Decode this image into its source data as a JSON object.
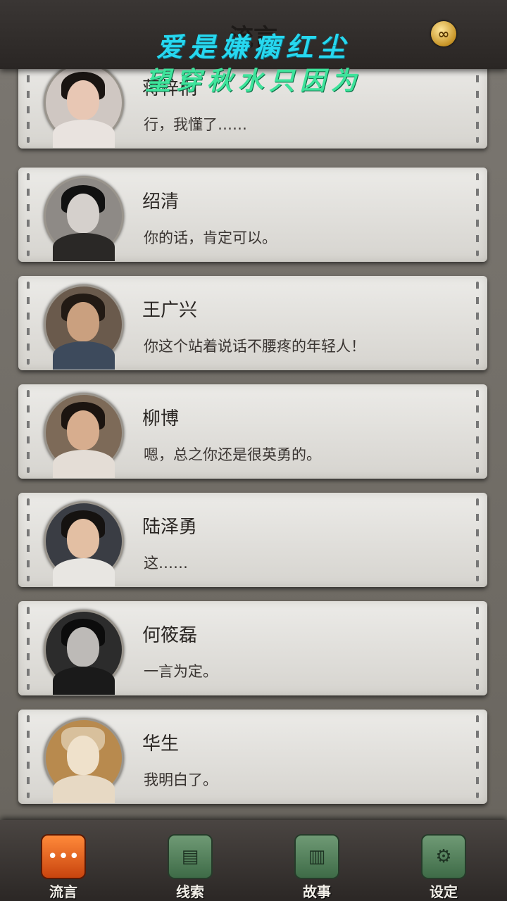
{
  "header": {
    "title": "流言",
    "overlay_line1": "爱是嫌瘸红尘",
    "overlay_line2": "望穿秋水只因为",
    "menu_icon": "infinity-coin-icon"
  },
  "messages": [
    {
      "name": "蒋梓桐",
      "text": "行，我懂了……",
      "avatar": "woman-avatar"
    },
    {
      "name": "绍清",
      "text": "你的话，肯定可以。",
      "avatar": "woman-avatar"
    },
    {
      "name": "王广兴",
      "text": "你这个站着说话不腰疼的年轻人！",
      "avatar": "man-glasses-avatar"
    },
    {
      "name": "柳博",
      "text": "嗯，总之你还是很英勇的。",
      "avatar": "man-avatar"
    },
    {
      "name": "陆泽勇",
      "text": "这……",
      "avatar": "man-glasses-avatar"
    },
    {
      "name": "何筱磊",
      "text": "一言为定。",
      "avatar": "man-glasses-avatar"
    },
    {
      "name": "华生",
      "text": "我明白了。",
      "avatar": "cat-avatar"
    }
  ],
  "nav": [
    {
      "label": "流言",
      "icon": "chat-bubble-icon",
      "active": true
    },
    {
      "label": "线索",
      "icon": "document-icon",
      "active": false
    },
    {
      "label": "故事",
      "icon": "book-icon",
      "active": false
    },
    {
      "label": "设定",
      "icon": "gear-icon",
      "active": false
    }
  ],
  "colors": {
    "active_tab": "#e8621c",
    "inactive_tab": "#4f7d58",
    "card": "#e2e1de",
    "overlay_cyan": "#27d8ef",
    "overlay_green": "#3ee39b"
  }
}
